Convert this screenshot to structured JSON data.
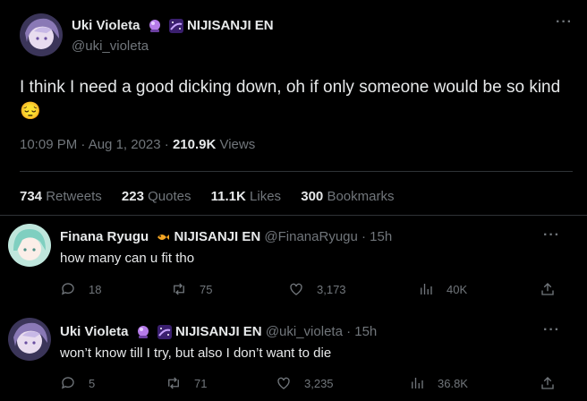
{
  "main_tweet": {
    "author_name": "Uki Violeta",
    "org": "NIJISANJI EN",
    "handle": "@uki_violeta",
    "text": "I think I need a good dicking down, oh if only someone would be so kind",
    "emoji": "😔",
    "time": "10:09 PM · Aug 1, 2023 · ",
    "views_count": "210.9K",
    "views_label": " Views",
    "stats": {
      "retweets": "734",
      "retweets_label": "Retweets",
      "quotes": "223",
      "quotes_label": "Quotes",
      "likes": "11.1K",
      "likes_label": "Likes",
      "bookmarks": "300",
      "bookmarks_label": "Bookmarks"
    }
  },
  "replies": [
    {
      "author_name": "Finana Ryugu",
      "org": "NIJISANJI EN",
      "handle": "@FinanaRyugu",
      "time": " · 15h",
      "text": "how many can u fit tho",
      "replies": "18",
      "retweets": "75",
      "likes": "3,173",
      "views": "40K"
    },
    {
      "author_name": "Uki Violeta",
      "org": "NIJISANJI EN",
      "handle": "@uki_violeta",
      "time": " · 15h",
      "text": "won’t know till I try, but also I don’t want to die",
      "replies": "5",
      "retweets": "71",
      "likes": "3,235",
      "views": "36.8K"
    }
  ],
  "icons": {
    "more": "more-dots-icon",
    "reply": "reply-icon",
    "retweet": "retweet-icon",
    "like": "heart-icon",
    "views": "views-icon",
    "share": "share-icon"
  },
  "colors": {
    "background": "#000000",
    "text": "#e7e9ea",
    "muted": "#71767b",
    "divider": "#2f3336"
  }
}
